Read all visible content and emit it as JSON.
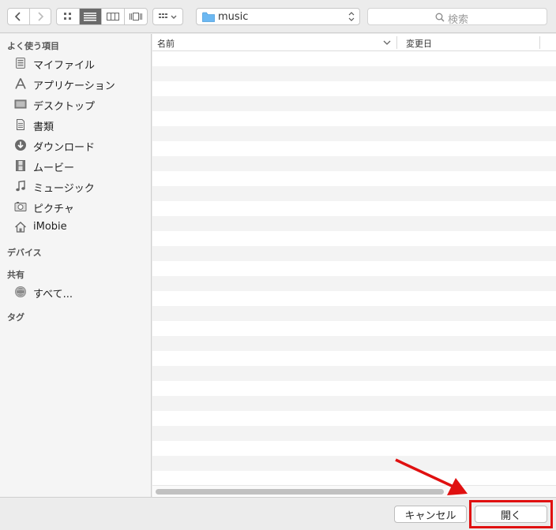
{
  "toolbar": {
    "path_popup_label": "music",
    "search_placeholder": "検索"
  },
  "sidebar": {
    "favorites_header": "よく使う項目",
    "favorites": [
      {
        "label": "マイファイル",
        "icon": "all-my-files-icon"
      },
      {
        "label": "アプリケーション",
        "icon": "applications-icon"
      },
      {
        "label": "デスクトップ",
        "icon": "desktop-icon"
      },
      {
        "label": "書類",
        "icon": "documents-icon"
      },
      {
        "label": "ダウンロード",
        "icon": "downloads-icon"
      },
      {
        "label": "ムービー",
        "icon": "movies-icon"
      },
      {
        "label": "ミュージック",
        "icon": "music-icon"
      },
      {
        "label": "ピクチャ",
        "icon": "pictures-icon"
      },
      {
        "label": "iMobie",
        "icon": "home-icon"
      }
    ],
    "devices_header": "デバイス",
    "shared_header": "共有",
    "shared": [
      {
        "label": "すべて...",
        "icon": "network-icon"
      }
    ],
    "tags_header": "タグ"
  },
  "list": {
    "col_name": "名前",
    "col_modified": "変更日"
  },
  "footer": {
    "cancel_label": "キャンセル",
    "open_label": "開く"
  },
  "colors": {
    "highlight": "#e01010",
    "arrow": "#e01010",
    "folder": "#6cb8f2"
  }
}
